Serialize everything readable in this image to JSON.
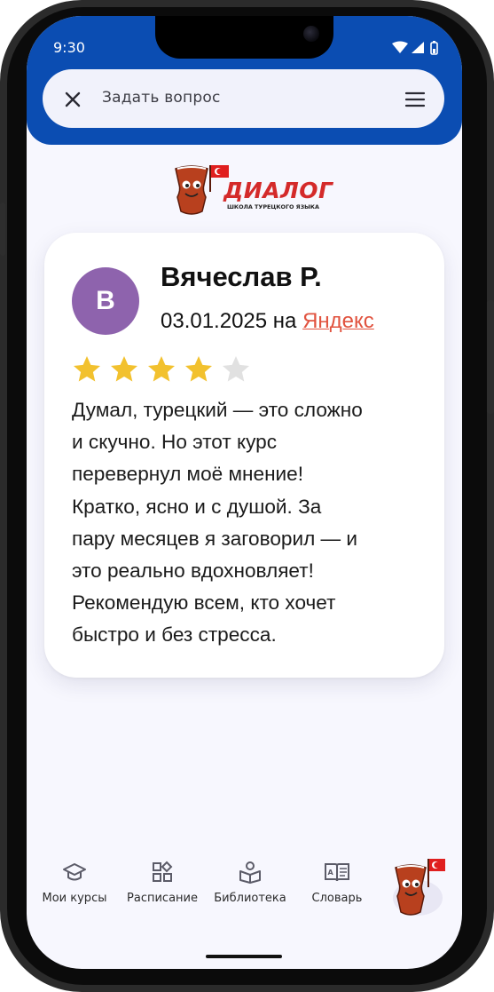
{
  "status_bar": {
    "time": "9:30"
  },
  "search": {
    "placeholder": "Задать вопрос"
  },
  "logo": {
    "word": "ДИАЛОГ",
    "tagline": "ШКОЛА ТУРЕЦКОГО ЯЗЫКА"
  },
  "review": {
    "avatar_letter": "B",
    "author": "Вячеслав Р.",
    "date": "03.01.2025",
    "source_prefix": "на",
    "source": "Яндекс",
    "rating": 4,
    "rating_max": 5,
    "text": "Думал, турецкий — это сложно\nи скучно. Но этот курс\nперевернул моё мнение!\nКратко, ясно и с душой. За\nпару месяцев я заговорил — и\nэто реально вдохновляет!\nРекомендую всем, кто хочет\nбыстро и без стресса."
  },
  "nav": {
    "items": [
      {
        "label": "Мои курсы",
        "icon": "graduation-cap-icon"
      },
      {
        "label": "Расписание",
        "icon": "grid-shapes-icon"
      },
      {
        "label": "Библиотека",
        "icon": "reader-book-icon"
      },
      {
        "label": "Словарь",
        "icon": "dictionary-book-icon"
      }
    ],
    "assistant_icon": "mascot-tea-glass-icon"
  },
  "colors": {
    "header": "#0b4db2",
    "avatar": "#8e63ad",
    "source_link": "#e1533f",
    "star_on": "#f2c12e",
    "star_off": "#e1e1e1"
  }
}
